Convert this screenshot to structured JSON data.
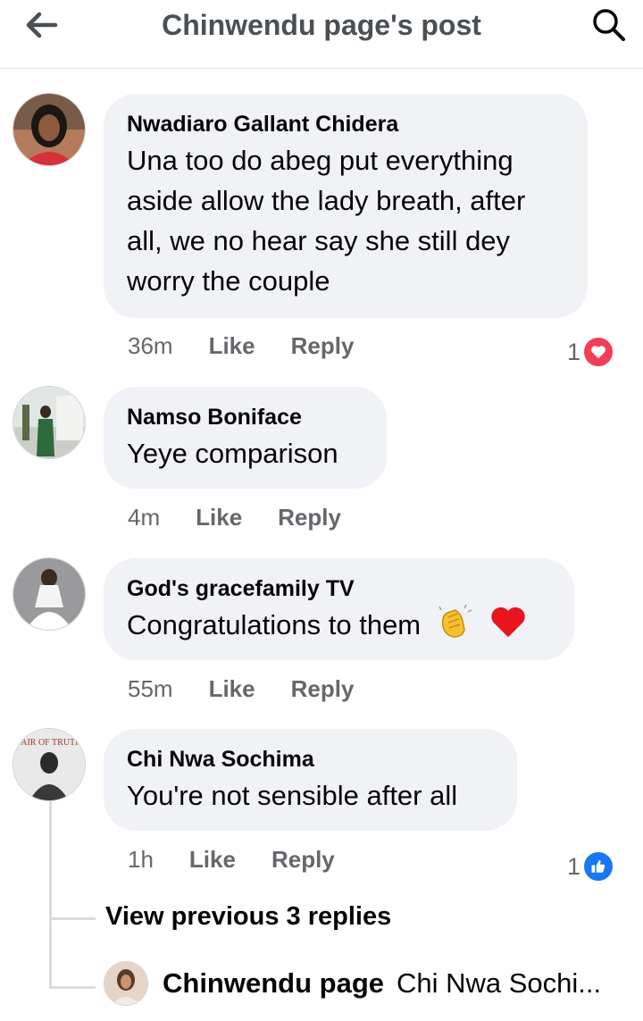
{
  "header": {
    "title": "Chinwendu page's post",
    "back_icon": "arrow-left-icon",
    "search_icon": "search-icon"
  },
  "comments": [
    {
      "author": "Nwadiaro Gallant Chidera",
      "text_lines": [
        "Una too do abeg put everything",
        "aside allow the lady breath, after",
        "all, we no hear say she still dey",
        "worry the couple"
      ],
      "time": "36m",
      "like_label": "Like",
      "reply_label": "Reply",
      "reaction_count": "1",
      "reaction_icon": "love-heart-icon",
      "reaction_color": "#f33e58"
    },
    {
      "author": "Namso Boniface",
      "text": "Yeye comparison",
      "time": "4m",
      "like_label": "Like",
      "reply_label": "Reply"
    },
    {
      "author": "God's gracefamily TV",
      "text": "Congratulations to them",
      "emojis": [
        "clapping-hands-emoji",
        "red-heart-emoji"
      ],
      "time": "55m",
      "like_label": "Like",
      "reply_label": "Reply"
    },
    {
      "author": "Chi Nwa Sochima",
      "text": "You're not sensible after all",
      "time": "1h",
      "like_label": "Like",
      "reply_label": "Reply",
      "reaction_count": "1",
      "reaction_icon": "like-thumb-icon",
      "reaction_color": "#1877f2",
      "avatar_caption": "PAIR OF TRUTH",
      "view_previous": "View previous 3 replies",
      "latest_reply": {
        "author": "Chinwendu page",
        "preview": "Chi Nwa Sochi..."
      }
    }
  ]
}
